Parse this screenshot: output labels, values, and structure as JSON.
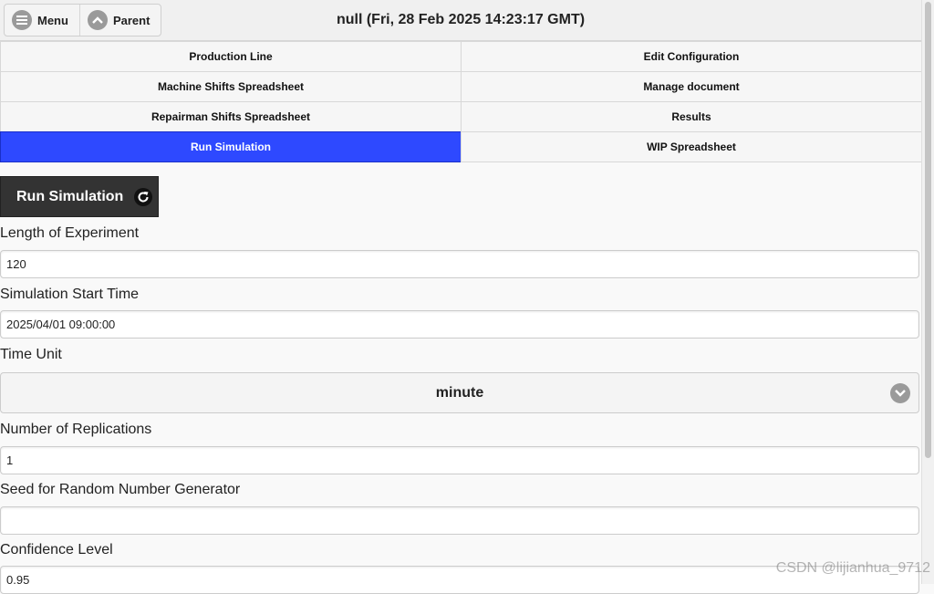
{
  "header": {
    "title": "null (Fri, 28 Feb 2025 14:23:17 GMT)",
    "menu_label": "Menu",
    "parent_label": "Parent"
  },
  "nav": {
    "items": [
      {
        "label": "Production Line",
        "active": false
      },
      {
        "label": "Edit Configuration",
        "active": false
      },
      {
        "label": "Machine Shifts Spreadsheet",
        "active": false
      },
      {
        "label": "Manage document",
        "active": false
      },
      {
        "label": "Repairman Shifts Spreadsheet",
        "active": false
      },
      {
        "label": "Results",
        "active": false
      },
      {
        "label": "Run Simulation",
        "active": true
      },
      {
        "label": "WIP Spreadsheet",
        "active": false
      }
    ]
  },
  "run_button": {
    "label": "Run Simulation",
    "icon": "refresh-icon"
  },
  "form": {
    "length": {
      "label": "Length of Experiment",
      "value": "120"
    },
    "start_time": {
      "label": "Simulation Start Time",
      "value": "2025/04/01 09:00:00"
    },
    "time_unit": {
      "label": "Time Unit",
      "value": "minute"
    },
    "replications": {
      "label": "Number of Replications",
      "value": "1"
    },
    "seed": {
      "label": "Seed for Random Number Generator",
      "value": ""
    },
    "confidence": {
      "label": "Confidence Level",
      "value": "0.95"
    }
  },
  "watermark": "CSDN @lijianhua_9712",
  "colors": {
    "active_nav": "#2e49ff",
    "run_button": "#333333"
  }
}
